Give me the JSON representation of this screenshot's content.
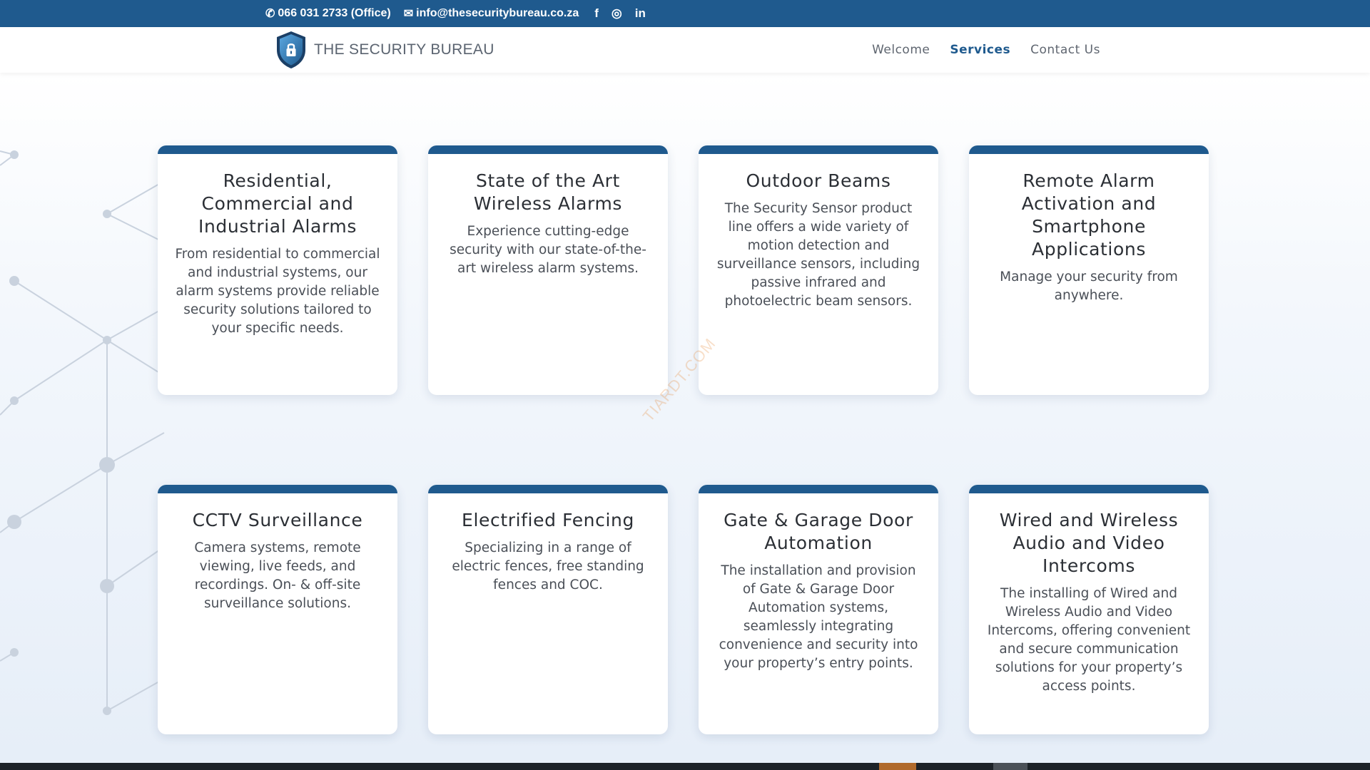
{
  "topbar": {
    "phone": "066 031 2733 (Office)",
    "email": "info@thesecuritybureau.co.za",
    "social": [
      {
        "icon": "facebook-icon",
        "glyph": "f"
      },
      {
        "icon": "instagram-icon",
        "glyph": "◎"
      },
      {
        "icon": "linkedin-icon",
        "glyph": "in"
      }
    ],
    "background_color": "#1f5a8e"
  },
  "header": {
    "brand": "THE SECURITY BUREAU",
    "nav": [
      {
        "label": "Welcome",
        "active": false
      },
      {
        "label": "Services",
        "active": true
      },
      {
        "label": "Contact Us",
        "active": false
      }
    ],
    "accent_color": "#1f5a8e"
  },
  "services": [
    {
      "title": "Residential, Commercial and Industrial Alarms",
      "description": "From residential to commercial and industrial systems, our alarm systems provide reliable security solutions tailored to your specific needs."
    },
    {
      "title": "State of the Art Wireless Alarms",
      "description": "Experience cutting-edge security with our state-of-the-art wireless alarm systems."
    },
    {
      "title": "Outdoor Beams",
      "description": "The Security Sensor product line offers a wide variety of motion detection and surveillance sensors, including passive infrared and photoelectric beam sensors."
    },
    {
      "title": "Remote Alarm Activation and Smartphone Applications",
      "description": "Manage your security from anywhere."
    },
    {
      "title": "CCTV Surveillance",
      "description": "Camera systems, remote viewing, live feeds, and recordings. On- & off-site surveillance solutions."
    },
    {
      "title": "Electrified Fencing",
      "description": "Specializing in a range of electric fences, free standing fences and COC."
    },
    {
      "title": "Gate & Garage Door Automation",
      "description": "The installation and provision of Gate & Garage Door Automation systems, seamlessly integrating convenience and security into your property’s entry points."
    },
    {
      "title": "Wired and Wireless Audio and Video Intercoms",
      "description": "The installing of Wired and Wireless Audio and Video Intercoms, offering convenient and secure communication solutions for your property’s access points."
    }
  ],
  "watermark": "TIARDT.COM"
}
